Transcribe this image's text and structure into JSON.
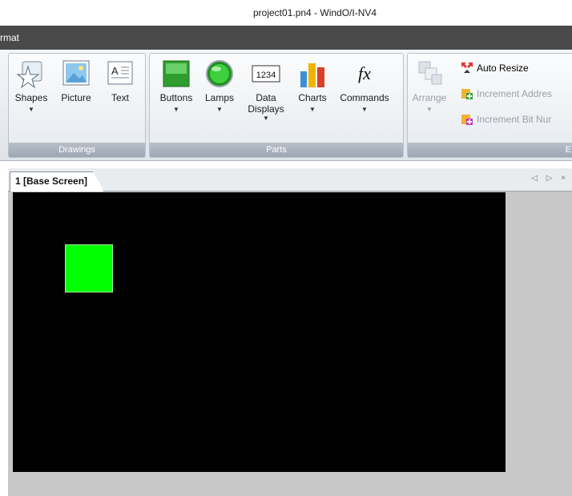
{
  "window": {
    "title": "project01.pn4 - WindO/I-NV4"
  },
  "menu": {
    "active_tab": "rmat"
  },
  "ribbon": {
    "drawings": {
      "label": "Drawings",
      "tools": [
        {
          "label": "Shapes",
          "arrow": "▼"
        },
        {
          "label": "Picture"
        },
        {
          "label": "Text"
        }
      ]
    },
    "parts": {
      "label": "Parts",
      "tools": [
        {
          "label": "Buttons",
          "arrow": "▼"
        },
        {
          "label": "Lamps",
          "arrow": "▼"
        },
        {
          "label_line1": "Data",
          "label_line2": "Displays",
          "arrow": "▼",
          "icon_text": "1234"
        },
        {
          "label": "Charts",
          "arrow": "▼"
        },
        {
          "label": "Commands",
          "arrow": "▼",
          "icon_text": "fx"
        }
      ]
    },
    "edit": {
      "label": "E",
      "arrange": {
        "label": "Arrange",
        "arrow": "▼"
      },
      "auto_resize": "Auto Resize",
      "increment_address": "Increment Addres",
      "increment_bit": "Increment Bit Nur"
    }
  },
  "document": {
    "tab_label": "1 [Base Screen]",
    "nav": "◁ ▷ ×"
  },
  "colors": {
    "canvas": "#000000",
    "lamp": "#00ff00",
    "menubar": "#4a4a4a",
    "workspace": "#c8c8c8"
  }
}
